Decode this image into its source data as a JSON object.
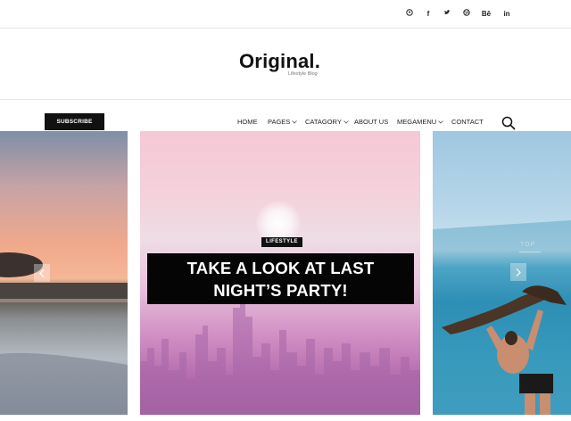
{
  "social": [
    {
      "name": "pinterest-icon",
      "glyph": "p"
    },
    {
      "name": "facebook-icon",
      "glyph": "f"
    },
    {
      "name": "twitter-icon",
      "glyph": "t"
    },
    {
      "name": "dribbble-icon",
      "glyph": "d"
    },
    {
      "name": "behance-icon",
      "glyph": "Bē"
    },
    {
      "name": "linkedin-icon",
      "glyph": "in"
    }
  ],
  "logo": {
    "title": "Original.",
    "tagline": "Lifestyle Blog"
  },
  "nav": {
    "subscribe": "SUBSCRIBE",
    "items": [
      "HOME",
      "PAGES",
      "CATAGORY",
      "ABOUT US",
      "MEGAMENU",
      "CONTACT"
    ]
  },
  "slider": {
    "category": "LIFESTYLE",
    "headline_line1": "TAKE A LOOK AT LAST",
    "headline_line2": "NIGHT’S PARTY!",
    "top_label": "TOP"
  },
  "colors": {
    "dark": "#111111",
    "accent_pink": "#d18fc4",
    "sea": "#2f8fb6"
  }
}
